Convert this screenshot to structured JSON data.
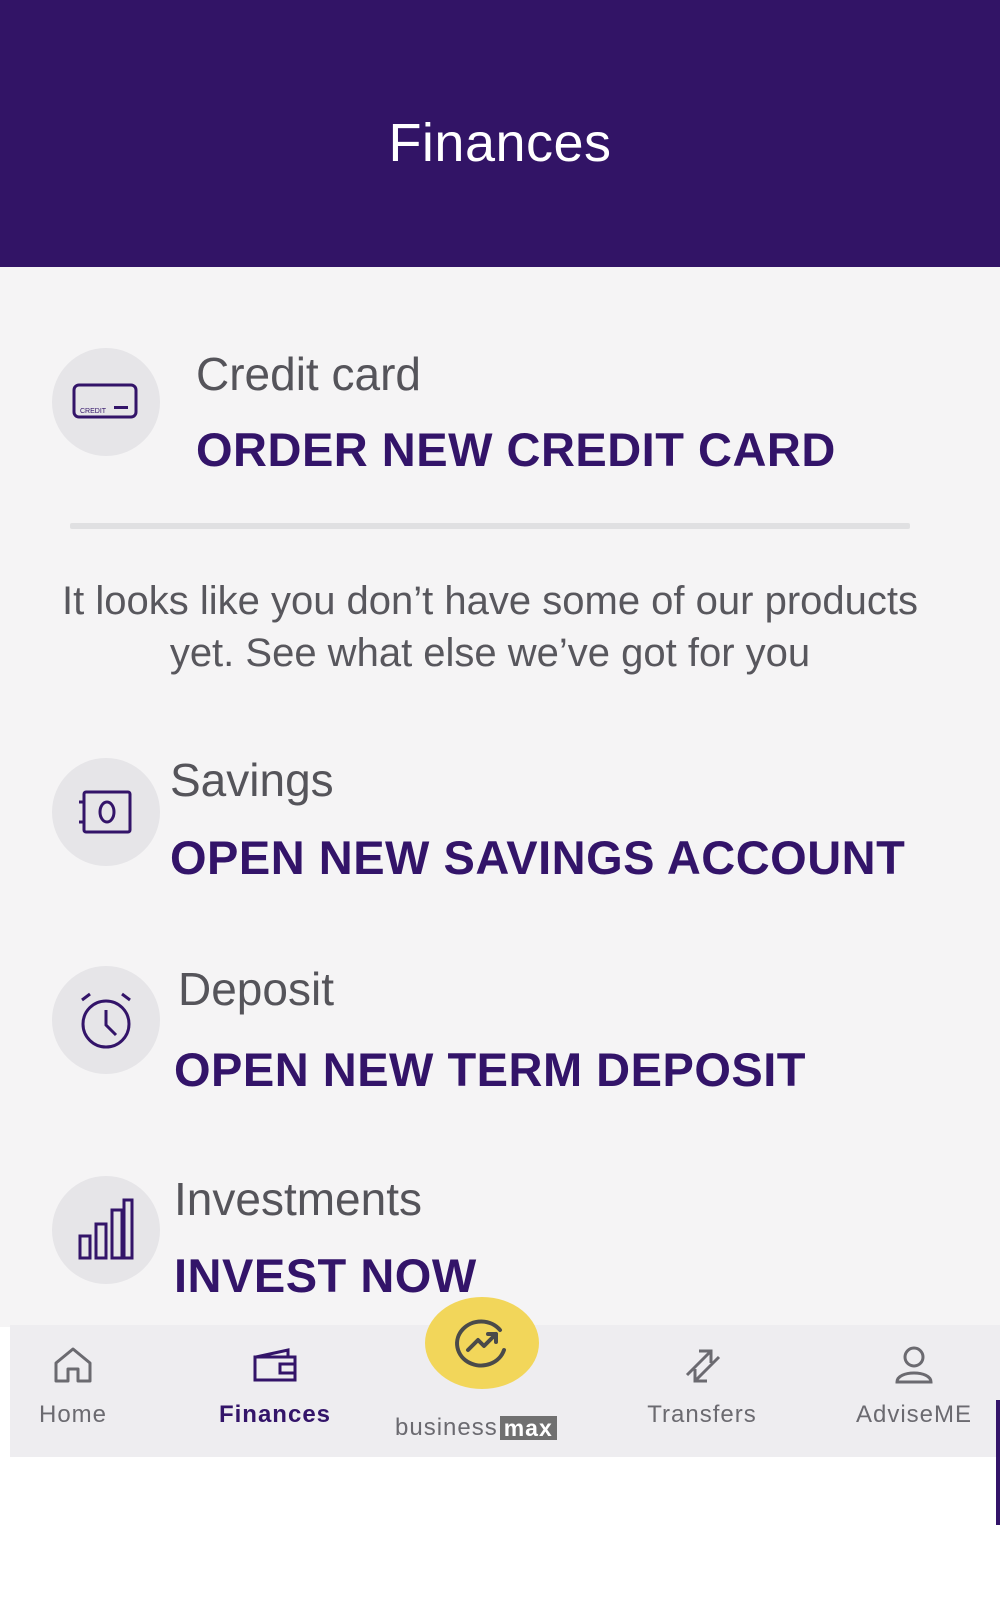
{
  "header": {
    "title": "Finances"
  },
  "products": {
    "credit_card": {
      "title": "Credit card",
      "action": "ORDER NEW CREDIT CARD",
      "icon_text": "CREDIT"
    },
    "promo_text": "It looks like you don’t have some of our products yet. See what else we’ve got for you",
    "savings": {
      "title": "Savings",
      "action": "OPEN NEW SAVINGS ACCOUNT"
    },
    "deposit": {
      "title": "Deposit",
      "action": "OPEN NEW TERM DEPOSIT"
    },
    "investments": {
      "title": "Investments",
      "action": "INVEST NOW"
    }
  },
  "tabbar": {
    "home": "Home",
    "finances": "Finances",
    "business_prefix": "business",
    "business_badge": "max",
    "transfers": "Transfers",
    "advise": "AdviseME",
    "active_tab": "finances"
  },
  "icons": {
    "credit_card": "credit-card-icon",
    "savings": "safe-icon",
    "deposit": "alarm-clock-icon",
    "investments": "bar-chart-icon",
    "home": "home-icon",
    "finances": "wallet-icon",
    "business": "trend-icon",
    "transfers": "transfer-arrows-icon",
    "advise": "user-icon"
  },
  "colors": {
    "brand": "#321466",
    "accent": "#f2d65a",
    "background": "#f5f4f5"
  }
}
